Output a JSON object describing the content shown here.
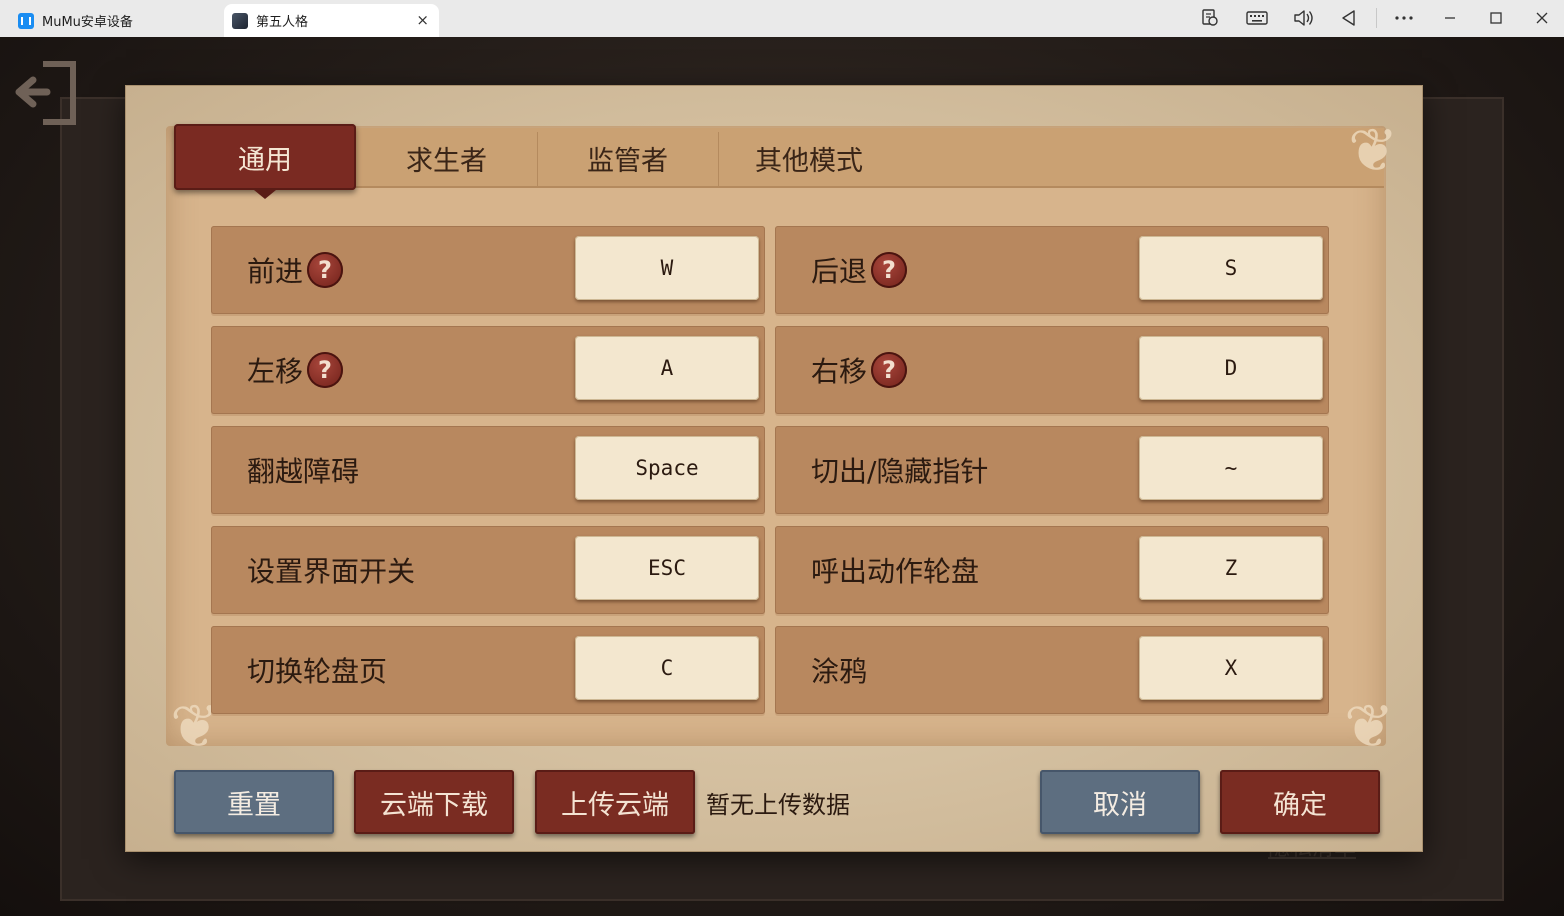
{
  "window": {
    "tabs": [
      {
        "label": "MuMu安卓设备",
        "icon": "mumu-app-icon"
      },
      {
        "label": "第五人格",
        "icon": "game-thumbnail-icon"
      }
    ],
    "tab_close_glyph": "×",
    "controls": [
      "screen-record-icon",
      "keyboard-icon",
      "volume-icon",
      "back-icon",
      "more-icon",
      "minimize-icon",
      "maximize-icon",
      "close-icon"
    ]
  },
  "background": {
    "link_text": "隐私清单"
  },
  "dialog": {
    "tabs": [
      "通用",
      "求生者",
      "监管者",
      "其他模式"
    ],
    "active_tab": "通用",
    "help_glyph": "?",
    "bindings_left": [
      {
        "label": "前进",
        "key": "W",
        "help": true
      },
      {
        "label": "左移",
        "key": "A",
        "help": true
      },
      {
        "label": "翻越障碍",
        "key": "Space",
        "help": false
      },
      {
        "label": "设置界面开关",
        "key": "ESC",
        "help": false
      },
      {
        "label": "切换轮盘页",
        "key": "C",
        "help": false
      }
    ],
    "bindings_right": [
      {
        "label": "后退",
        "key": "S",
        "help": true
      },
      {
        "label": "右移",
        "key": "D",
        "help": true
      },
      {
        "label": "切出/隐藏指针",
        "key": "~",
        "help": false
      },
      {
        "label": "呼出动作轮盘",
        "key": "Z",
        "help": false
      },
      {
        "label": "涂鸦",
        "key": "X",
        "help": false
      }
    ],
    "footer": {
      "reset": "重置",
      "cloud_download": "云端下载",
      "cloud_upload": "上传云端",
      "upload_status": "暂无上传数据",
      "cancel": "取消",
      "confirm": "确定"
    }
  },
  "colors": {
    "active_tab": "#7a2a22",
    "blue_button": "#5d6e80",
    "red_button": "#7a2c22",
    "key_cap": "#f3e7cf",
    "row_bg": "#b8885f"
  }
}
